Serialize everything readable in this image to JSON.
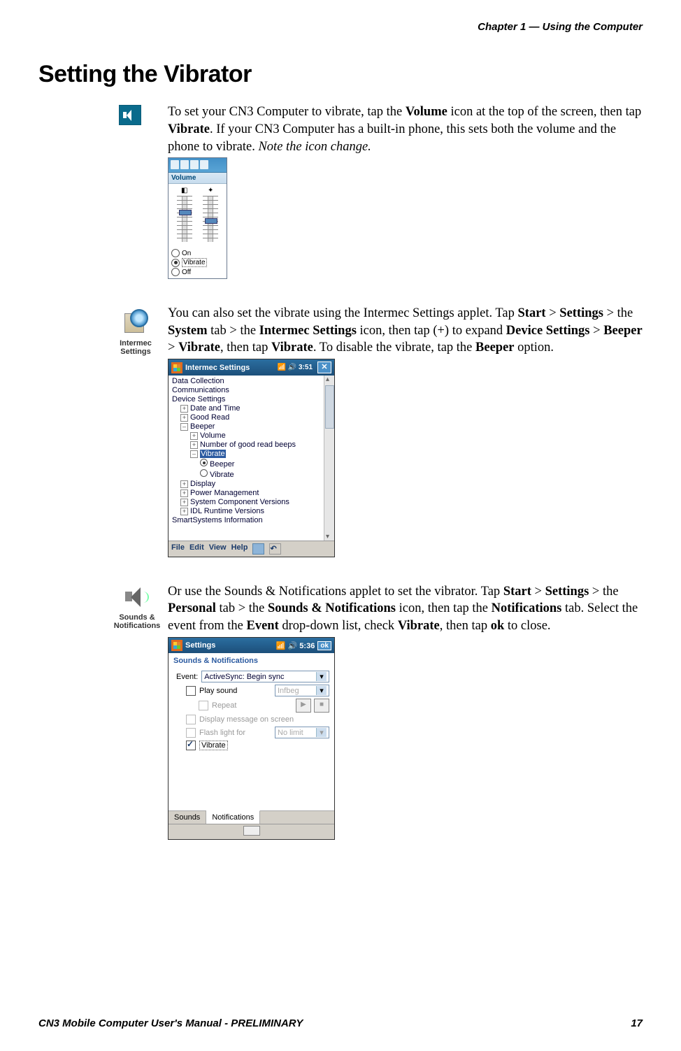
{
  "header": {
    "chapter_ref": "Chapter 1 —  Using the Computer"
  },
  "heading": "Setting the Vibrator",
  "para1": {
    "pre": "To set your CN3 Computer to vibrate, tap the ",
    "b1": "Volume",
    "mid1": " icon at the top of the screen, then tap ",
    "b2": "Vibrate",
    "mid2": ". If your CN3 Computer has a built-in phone, this sets both the volume and the phone to vibrate. ",
    "ital": "Note the icon change."
  },
  "vol_popup": {
    "label": "Volume",
    "radios": {
      "on": "On",
      "vibrate": "Vibrate",
      "off": "Off"
    }
  },
  "para2": {
    "icon_label": "Intermec Settings",
    "pre": "You can also set the vibrate using the Intermec Settings applet. Tap ",
    "b1": "Start",
    "gt1": " > ",
    "b2": "Settings",
    "gt2": " > the ",
    "b3": "System",
    "mid1": " tab > the ",
    "b4": "Intermec Settings",
    "mid2": " icon, then tap (+) to expand ",
    "b5": "Device Settings",
    "gt3": " > ",
    "b6": "Beeper",
    "gt4": " > ",
    "b7": "Vibrate",
    "mid3": ", then tap ",
    "b8": "Vibrate",
    "mid4": ". To disable the vibrate, tap the ",
    "b9": "Beeper",
    "tail": " option."
  },
  "intermec_shot": {
    "title": "Intermec Settings",
    "time": "3:51",
    "tree": {
      "data_collection": "Data Collection",
      "communications": "Communications",
      "device_settings": "Device Settings",
      "date_time": "Date and Time",
      "good_read": "Good Read",
      "beeper": "Beeper",
      "volume": "Volume",
      "num_beeps": "Number of good read beeps",
      "vibrate": "Vibrate",
      "opt_beeper": "Beeper",
      "opt_vibrate": "Vibrate",
      "display": "Display",
      "power": "Power Management",
      "sys_comp": "System Component Versions",
      "idl": "IDL Runtime Versions",
      "smartsys": "SmartSystems Information"
    },
    "menu": {
      "file": "File",
      "edit": "Edit",
      "view": "View",
      "help": "Help"
    }
  },
  "para3": {
    "icon_label": "Sounds & Notifications",
    "pre": "Or use the Sounds & Notifications applet to set the vibrator. Tap ",
    "b1": "Start",
    "gt1": " > ",
    "b2": "Settings",
    "gt2": " > the ",
    "b3": "Personal",
    "mid1": " tab > the ",
    "b4": "Sounds & Notifications",
    "mid2": " icon, then tap the ",
    "b5": "Notifications",
    "mid3": " tab. Select the event from the ",
    "b6": "Event",
    "mid4": " drop-down list, check ",
    "b7": "Vibrate",
    "mid5": ", then tap ",
    "b8": "ok",
    "tail": " to close."
  },
  "sounds_shot": {
    "title": "Settings",
    "time": "5:36",
    "ok": "ok",
    "subtitle": "Sounds & Notifications",
    "event_label": "Event:",
    "event_value": "ActiveSync: Begin sync",
    "play_sound": "Play sound",
    "sound_value": "Infbeg",
    "repeat": "Repeat",
    "display_msg": "Display message on screen",
    "flash": "Flash light for",
    "flash_value": "No limit",
    "vibrate": "Vibrate",
    "tab_sounds": "Sounds",
    "tab_notifications": "Notifications"
  },
  "footer": {
    "left": "CN3 Mobile Computer User's Manual - PRELIMINARY",
    "right": "17"
  }
}
